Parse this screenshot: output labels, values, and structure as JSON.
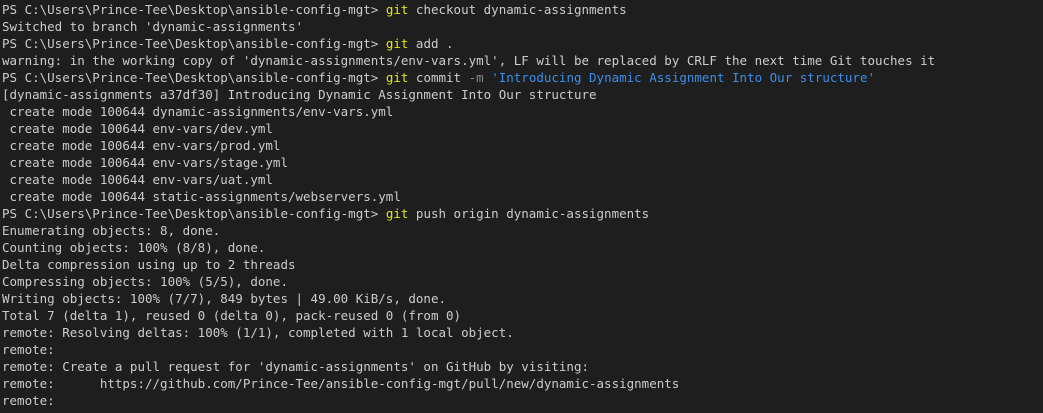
{
  "terminal": {
    "lines": [
      {
        "kind": "prompt",
        "prompt": "PS C:\\Users\\Prince-Tee\\Desktop\\ansible-config-mgt> ",
        "cmd": "git",
        "args": " checkout dynamic-assignments"
      },
      {
        "kind": "output",
        "text": "Switched to branch 'dynamic-assignments'"
      },
      {
        "kind": "prompt",
        "prompt": "PS C:\\Users\\Prince-Tee\\Desktop\\ansible-config-mgt> ",
        "cmd": "git",
        "args": " add ."
      },
      {
        "kind": "output",
        "text": "warning: in the working copy of 'dynamic-assignments/env-vars.yml', LF will be replaced by CRLF the next time Git touches it"
      },
      {
        "kind": "commit",
        "prompt": "PS C:\\Users\\Prince-Tee\\Desktop\\ansible-config-mgt> ",
        "cmd": "git",
        "args": " commit ",
        "flag": "-m",
        "str": " 'Introducing Dynamic Assignment Into Our structure'"
      },
      {
        "kind": "output",
        "text": "[dynamic-assignments a37df30] Introducing Dynamic Assignment Into Our structure"
      },
      {
        "kind": "output",
        "text": " create mode 100644 dynamic-assignments/env-vars.yml"
      },
      {
        "kind": "output",
        "text": " create mode 100644 env-vars/dev.yml"
      },
      {
        "kind": "output",
        "text": " create mode 100644 env-vars/prod.yml"
      },
      {
        "kind": "output",
        "text": " create mode 100644 env-vars/stage.yml"
      },
      {
        "kind": "output",
        "text": " create mode 100644 env-vars/uat.yml"
      },
      {
        "kind": "output",
        "text": " create mode 100644 static-assignments/webservers.yml"
      },
      {
        "kind": "prompt",
        "prompt": "PS C:\\Users\\Prince-Tee\\Desktop\\ansible-config-mgt> ",
        "cmd": "git",
        "args": " push origin dynamic-assignments"
      },
      {
        "kind": "output",
        "text": "Enumerating objects: 8, done."
      },
      {
        "kind": "output",
        "text": "Counting objects: 100% (8/8), done."
      },
      {
        "kind": "output",
        "text": "Delta compression using up to 2 threads"
      },
      {
        "kind": "output",
        "text": "Compressing objects: 100% (5/5), done."
      },
      {
        "kind": "output",
        "text": "Writing objects: 100% (7/7), 849 bytes | 49.00 KiB/s, done."
      },
      {
        "kind": "output",
        "text": "Total 7 (delta 1), reused 0 (delta 0), pack-reused 0 (from 0)"
      },
      {
        "kind": "output",
        "text": "remote: Resolving deltas: 100% (1/1), completed with 1 local object."
      },
      {
        "kind": "output",
        "text": "remote:"
      },
      {
        "kind": "output",
        "text": "remote: Create a pull request for 'dynamic-assignments' on GitHub by visiting:"
      },
      {
        "kind": "output",
        "text": "remote:      https://github.com/Prince-Tee/ansible-config-mgt/pull/new/dynamic-assignments"
      },
      {
        "kind": "output",
        "text": "remote:"
      }
    ]
  },
  "colors": {
    "background": "#1e1e1e",
    "text": "#cccccc",
    "command": "#e5e510",
    "flag": "#888888",
    "string": "#3b8eea"
  }
}
